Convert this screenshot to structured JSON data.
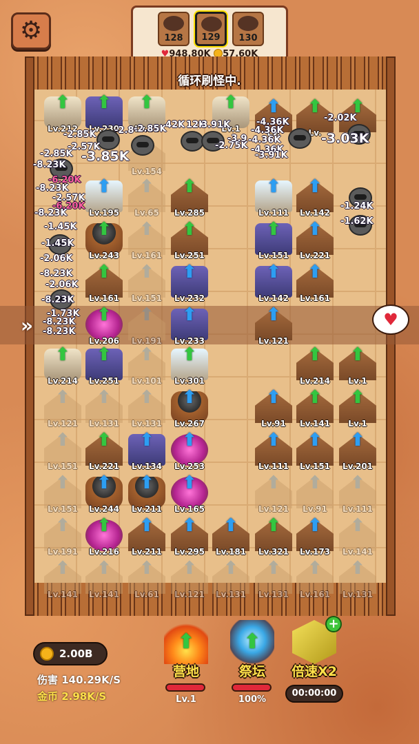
{
  "settings_icon": "gear-icon",
  "heroes": [
    {
      "count": "128"
    },
    {
      "count": "129"
    },
    {
      "count": "130"
    }
  ],
  "stats": {
    "hp": "948.80K",
    "gold": "57.60K"
  },
  "status": "循环刷怪中.",
  "towers": [
    {
      "kind": "light",
      "lv": "Lv.212",
      "arrow": "green"
    },
    {
      "kind": "crystal",
      "lv": "Lv.230",
      "arrow": "green"
    },
    {
      "kind": "light",
      "lv": "Lv.21",
      "arrow": "green"
    },
    {
      "kind": "light",
      "lv": "Lv.1",
      "arrow": "green"
    },
    {
      "kind": "hut",
      "lv": "Lv.",
      "arrow": "blue"
    },
    {
      "kind": "hut",
      "lv": "Lv.",
      "arrow": "green"
    },
    {
      "kind": "hut",
      "lv": "Lv.",
      "arrow": "green"
    },
    {
      "kind": "ghost",
      "lv": "Lv.154",
      "arrow": "grey"
    },
    {
      "kind": "ice",
      "lv": "Lv.195",
      "arrow": "blue"
    },
    {
      "kind": "ghost",
      "lv": "Lv.65",
      "arrow": "grey"
    },
    {
      "kind": "hut",
      "lv": "Lv.285",
      "arrow": "green"
    },
    {
      "kind": "ice",
      "lv": "Lv.111",
      "arrow": "blue"
    },
    {
      "kind": "hut",
      "lv": "Lv.142",
      "arrow": "blue"
    },
    {
      "kind": "pot",
      "lv": "Lv.243",
      "arrow": "green"
    },
    {
      "kind": "ghost",
      "lv": "Lv.161",
      "arrow": "grey"
    },
    {
      "kind": "hut",
      "lv": "Lv.251",
      "arrow": "green"
    },
    {
      "kind": "crystal",
      "lv": "Lv.151",
      "arrow": "green"
    },
    {
      "kind": "hut",
      "lv": "Lv.221",
      "arrow": "blue"
    },
    {
      "kind": "hut",
      "lv": "Lv.161",
      "arrow": "green"
    },
    {
      "kind": "ghost",
      "lv": "Lv.151",
      "arrow": "grey"
    },
    {
      "kind": "crystal",
      "lv": "Lv.232",
      "arrow": "blue"
    },
    {
      "kind": "crystal",
      "lv": "Lv.142",
      "arrow": "blue"
    },
    {
      "kind": "hut",
      "lv": "Lv.161",
      "arrow": "blue"
    },
    {
      "kind": "pink",
      "lv": "Lv.206",
      "arrow": "green"
    },
    {
      "kind": "ghost",
      "lv": "Lv.191",
      "arrow": "grey"
    },
    {
      "kind": "crystal",
      "lv": "Lv.233",
      "arrow": "blue"
    },
    {
      "kind": "hut",
      "lv": "Lv.121",
      "arrow": "blue"
    },
    {
      "kind": "light",
      "lv": "Lv.214",
      "arrow": "green"
    },
    {
      "kind": "crystal",
      "lv": "Lv.251",
      "arrow": "green"
    },
    {
      "kind": "ghost",
      "lv": "Lv.101",
      "arrow": "grey"
    },
    {
      "kind": "ice",
      "lv": "Lv.301",
      "arrow": "green"
    },
    {
      "kind": "hut",
      "lv": "Lv.214",
      "arrow": "green"
    },
    {
      "kind": "hut",
      "lv": "Lv.1",
      "arrow": "green"
    },
    {
      "kind": "ghost",
      "lv": "Lv.121",
      "arrow": "grey"
    },
    {
      "kind": "ghost",
      "lv": "Lv.131",
      "arrow": "grey"
    },
    {
      "kind": "ghost",
      "lv": "Lv.131",
      "arrow": "grey"
    },
    {
      "kind": "pot",
      "lv": "Lv.267",
      "arrow": "blue"
    },
    {
      "kind": "hut",
      "lv": "Lv.91",
      "arrow": "blue"
    },
    {
      "kind": "hut",
      "lv": "Lv.141",
      "arrow": "green"
    },
    {
      "kind": "hut",
      "lv": "Lv.1",
      "arrow": "green"
    },
    {
      "kind": "ghost",
      "lv": "Lv.151",
      "arrow": "grey"
    },
    {
      "kind": "hut",
      "lv": "Lv.221",
      "arrow": "green"
    },
    {
      "kind": "crystal",
      "lv": "Lv.134",
      "arrow": "blue"
    },
    {
      "kind": "pink",
      "lv": "Lv.253",
      "arrow": "blue"
    },
    {
      "kind": "hut",
      "lv": "Lv.111",
      "arrow": "blue"
    },
    {
      "kind": "hut",
      "lv": "Lv.151",
      "arrow": "blue"
    },
    {
      "kind": "hut",
      "lv": "Lv.201",
      "arrow": "blue"
    },
    {
      "kind": "ghost",
      "lv": "Lv.151",
      "arrow": "grey"
    },
    {
      "kind": "pot",
      "lv": "Lv.244",
      "arrow": "blue"
    },
    {
      "kind": "pot",
      "lv": "Lv.211",
      "arrow": "blue"
    },
    {
      "kind": "pink",
      "lv": "Lv.165",
      "arrow": "blue"
    },
    {
      "kind": "ghost",
      "lv": "Lv.121",
      "arrow": "grey"
    },
    {
      "kind": "ghost",
      "lv": "Lv.91",
      "arrow": "grey"
    },
    {
      "kind": "ghost",
      "lv": "Lv.111",
      "arrow": "grey"
    },
    {
      "kind": "ghost",
      "lv": "Lv.191",
      "arrow": "grey"
    },
    {
      "kind": "pink",
      "lv": "Lv.216",
      "arrow": "green"
    },
    {
      "kind": "hut",
      "lv": "Lv.211",
      "arrow": "blue"
    },
    {
      "kind": "hut",
      "lv": "Lv.295",
      "arrow": "blue"
    },
    {
      "kind": "hut",
      "lv": "Lv.181",
      "arrow": "blue"
    },
    {
      "kind": "hut",
      "lv": "Lv.321",
      "arrow": "green"
    },
    {
      "kind": "hut",
      "lv": "Lv.173",
      "arrow": "blue"
    },
    {
      "kind": "ghost",
      "lv": "Lv.141",
      "arrow": "grey"
    },
    {
      "kind": "ghost",
      "lv": "Lv.141",
      "arrow": "grey"
    },
    {
      "kind": "ghost",
      "lv": "Lv.141",
      "arrow": "grey"
    },
    {
      "kind": "ghost",
      "lv": "Lv.61",
      "arrow": "grey"
    },
    {
      "kind": "ghost",
      "lv": "Lv.121",
      "arrow": "grey"
    },
    {
      "kind": "ghost",
      "lv": "Lv.131",
      "arrow": "grey"
    },
    {
      "kind": "ghost",
      "lv": "Lv.131",
      "arrow": "grey"
    },
    {
      "kind": "ghost",
      "lv": "Lv.161",
      "arrow": "grey"
    },
    {
      "kind": "ghost",
      "lv": "Lv.131",
      "arrow": "grey"
    }
  ],
  "damage": [
    {
      "t": "-3.85K",
      "big": true
    },
    {
      "t": "-3.03K",
      "big": true
    },
    {
      "t": "-2.85K"
    },
    {
      "t": "-2.85K"
    },
    {
      "t": "-2.57K"
    },
    {
      "t": "-2.8"
    },
    {
      "t": "-8.23K"
    },
    {
      "t": "-6.20K",
      "pink": true
    },
    {
      "t": "-8.23K"
    },
    {
      "t": "-2.57K"
    },
    {
      "t": "-6.20K",
      "pink": true
    },
    {
      "t": "-8.23K"
    },
    {
      "t": "-1.45K"
    },
    {
      "t": "-1.45K"
    },
    {
      "t": "-2.06K"
    },
    {
      "t": "-8.23K"
    },
    {
      "t": "-2.06K"
    },
    {
      "t": "-8.23K"
    },
    {
      "t": "-1.73K"
    },
    {
      "t": "-8.23K"
    },
    {
      "t": "-8.23K"
    },
    {
      "t": "-2.85K"
    },
    {
      "t": "42K"
    },
    {
      "t": "12K"
    },
    {
      "t": "3.91K"
    },
    {
      "t": "-4.36K"
    },
    {
      "t": "-4.36K"
    },
    {
      "t": "-4.36K"
    },
    {
      "t": "-4.36K"
    },
    {
      "t": "-3.91K"
    },
    {
      "t": "-2.02K"
    },
    {
      "t": "-1.24K"
    },
    {
      "t": "-1.62K"
    },
    {
      "t": "-2.75K"
    },
    {
      "t": "-3.9"
    }
  ],
  "hud": {
    "money": "2.00B",
    "dps": "伤害 140.29K/S",
    "gps": "金币 2.98K/S",
    "camp_label": "营地",
    "camp_sub": "Lv.1",
    "altar_label": "祭坛",
    "altar_sub": "100%",
    "boost_label": "倍速X2",
    "boost_timer": "00:00:00"
  },
  "colors": {
    "hp": "#e0283a",
    "gold": "#f4b21a",
    "upgrade": "#33c640",
    "blue_upgrade": "#2d9ef2"
  }
}
